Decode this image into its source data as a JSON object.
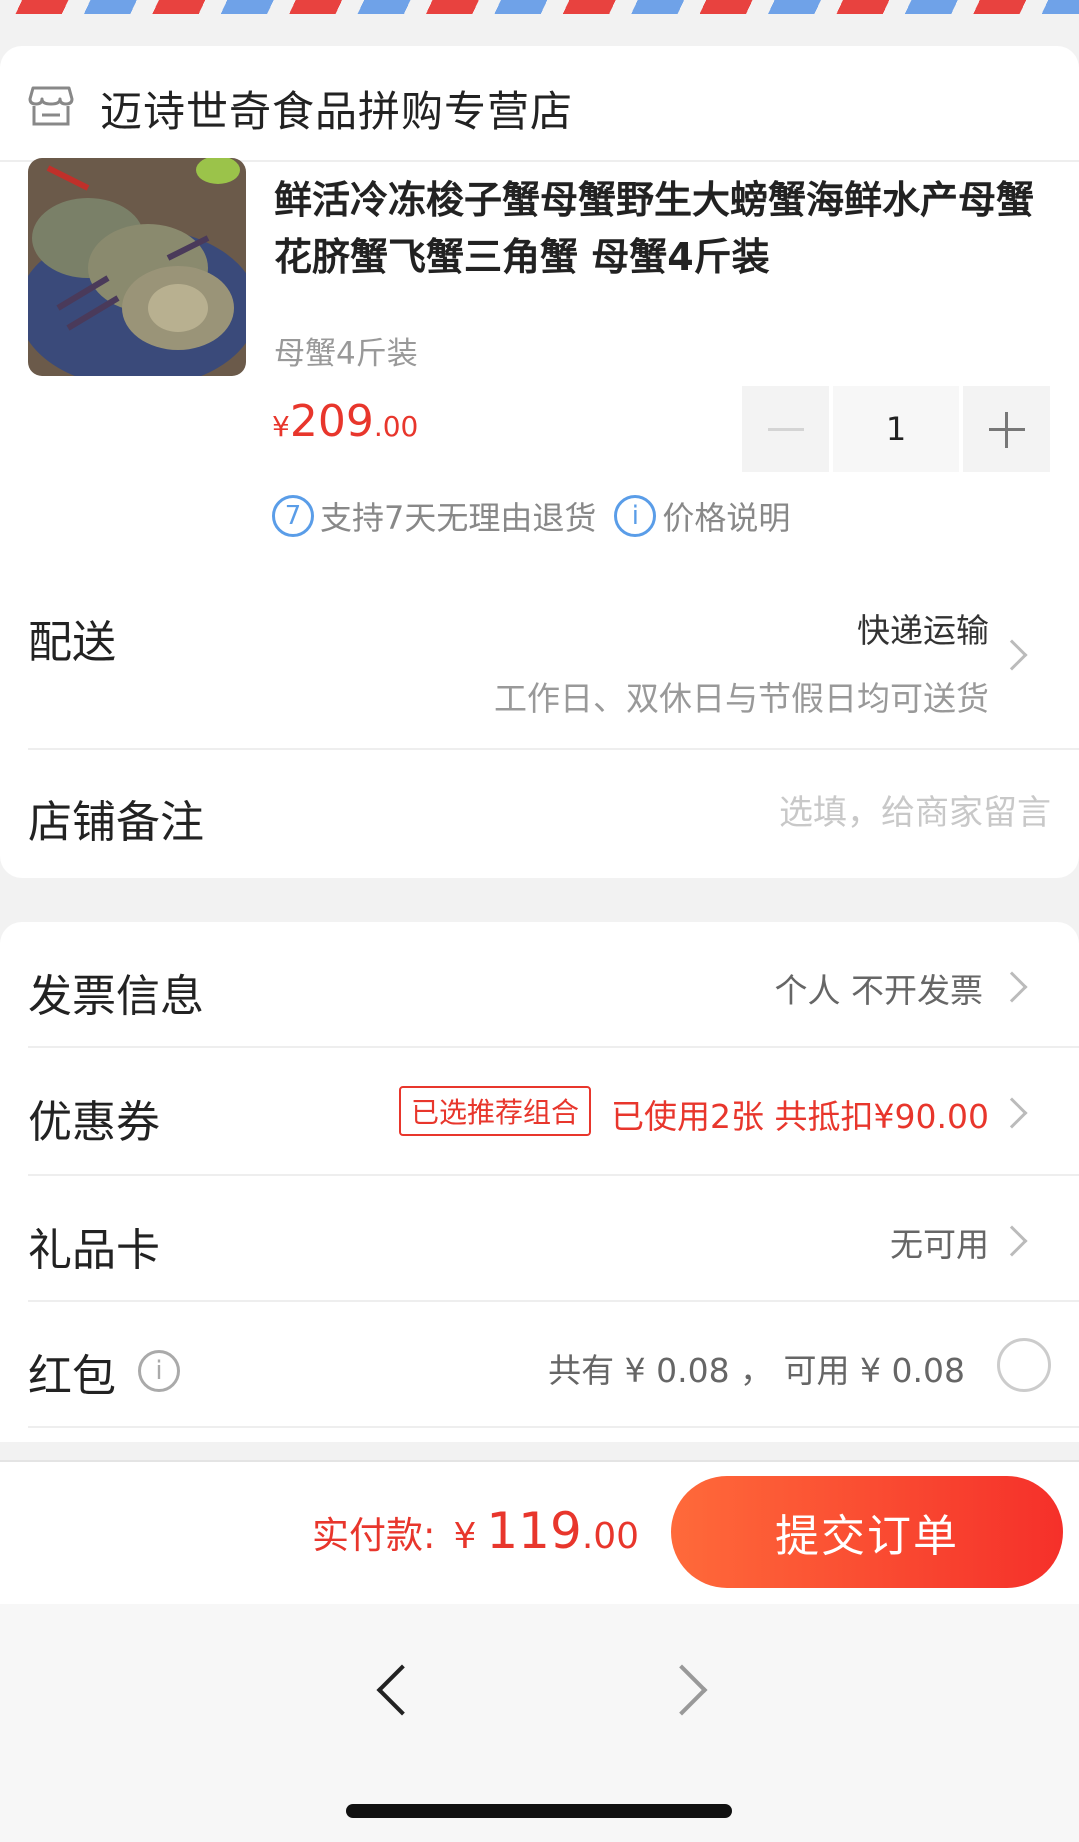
{
  "store": {
    "name": "迈诗世奇食品拼购专营店",
    "icon": "store-icon"
  },
  "product": {
    "title": "鲜活冷冻梭子蟹母蟹野生大螃蟹海鲜水产母蟹花脐蟹飞蟹三角蟹 母蟹4斤装",
    "sku": "母蟹4斤装",
    "price_currency": "¥",
    "price_int": "209",
    "price_dec": ".00",
    "quantity": "1",
    "services": [
      {
        "badge": "7",
        "label": "支持7天无理由退货"
      },
      {
        "badge": "i",
        "label": "价格说明"
      }
    ]
  },
  "delivery": {
    "label": "配送",
    "method": "快递运输",
    "note": "工作日、双休日与节假日均可送货"
  },
  "remark": {
    "label": "店铺备注",
    "placeholder": "选填，给商家留言",
    "value": ""
  },
  "invoice": {
    "label": "发票信息",
    "value": "个人 不开发票"
  },
  "coupon": {
    "label": "优惠券",
    "tag": "已选推荐组合",
    "value": "已使用2张 共抵扣¥90.00"
  },
  "gift_card": {
    "label": "礼品卡",
    "value": "无可用"
  },
  "red_packet": {
    "label": "红包",
    "value": "共有 ¥ 0.08 ，  可用 ¥ 0.08",
    "checked": false
  },
  "checkout": {
    "total_label": "实付款:",
    "total_currency": "¥",
    "total_int": "119",
    "total_dec": ".00",
    "submit_label": "提交订单"
  },
  "colors": {
    "accent": "#e8362c",
    "submit_start": "#ff6a3a",
    "submit_end": "#f5302a",
    "service_blue": "#5a9de8"
  }
}
